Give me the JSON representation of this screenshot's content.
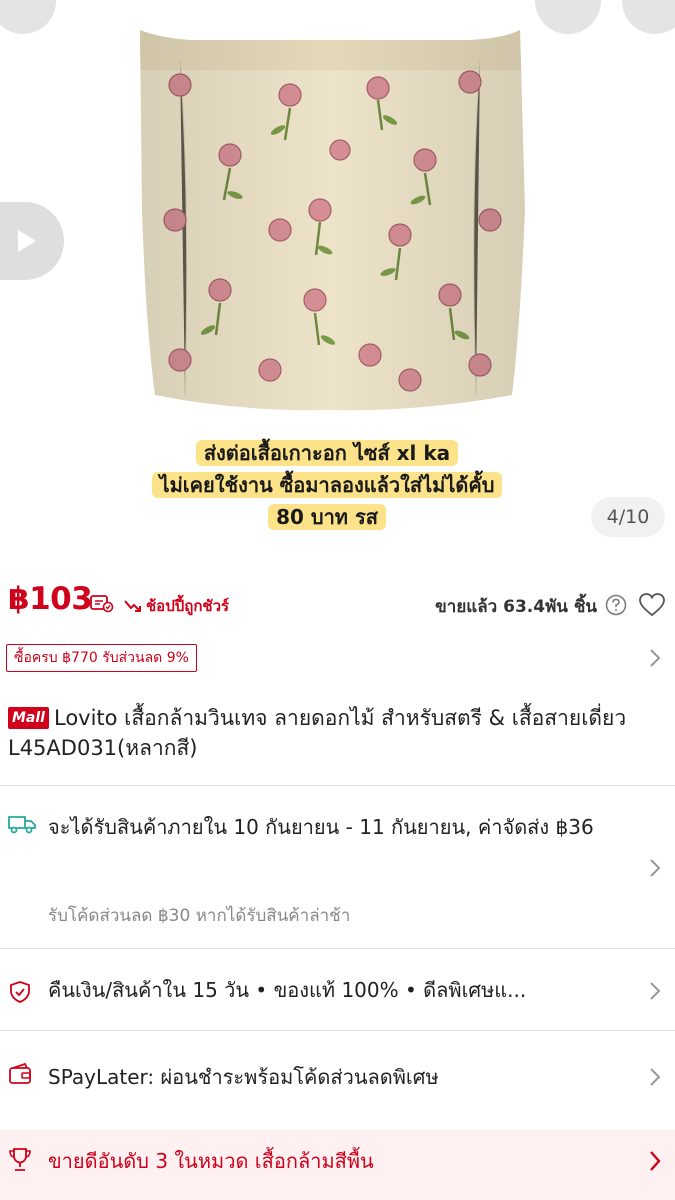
{
  "gallery": {
    "caption_lines": [
      "ส่งต่อเสื้อเกาะอก ไซส์ xl ka",
      "ไม่เคยใช้งาน ซื้อมาลองแล้วใส่ไม่ได้คั้บ",
      "80 บาท รส"
    ],
    "counter": "4/10"
  },
  "price": {
    "value": "฿103",
    "guarantee": "ช้อปปี้ถูกชัวร์",
    "sold": "ขายแล้ว 63.4พัน ชิ้น"
  },
  "discount": {
    "tag": "ซื้อครบ ฿770 รับส่วนลด 9%"
  },
  "product": {
    "mall_badge": "Mall",
    "title": "Lovito เสื้อกล้ามวินเทจ ลายดอกไม้ สำหรับสตรี & เสื้อสายเดี่ยว L45AD031(หลากสี)"
  },
  "shipping": {
    "text": "จะได้รับสินค้าภายใน 10 กันยายน - 11 กันยายน, ค่าจัดส่ง ฿36",
    "sub": "รับโค้ดส่วนลด ฿30 หากได้รับสินค้าล่าช้า"
  },
  "guarantee_row": {
    "text": "คืนเงิน/สินค้าใน 15 วัน  •  ของแท้ 100%  •  ดีลพิเศษแ..."
  },
  "spaylater": {
    "text": "SPayLater: ผ่อนชำระพร้อมโค้ดส่วนลดพิเศษ"
  },
  "bestseller": {
    "text": "ขายดีอันดับ 3 ในหมวด เสื้อกล้ามสีพื้น"
  },
  "colors": {
    "accent": "#d0011b",
    "highlight": "#fce38a"
  }
}
